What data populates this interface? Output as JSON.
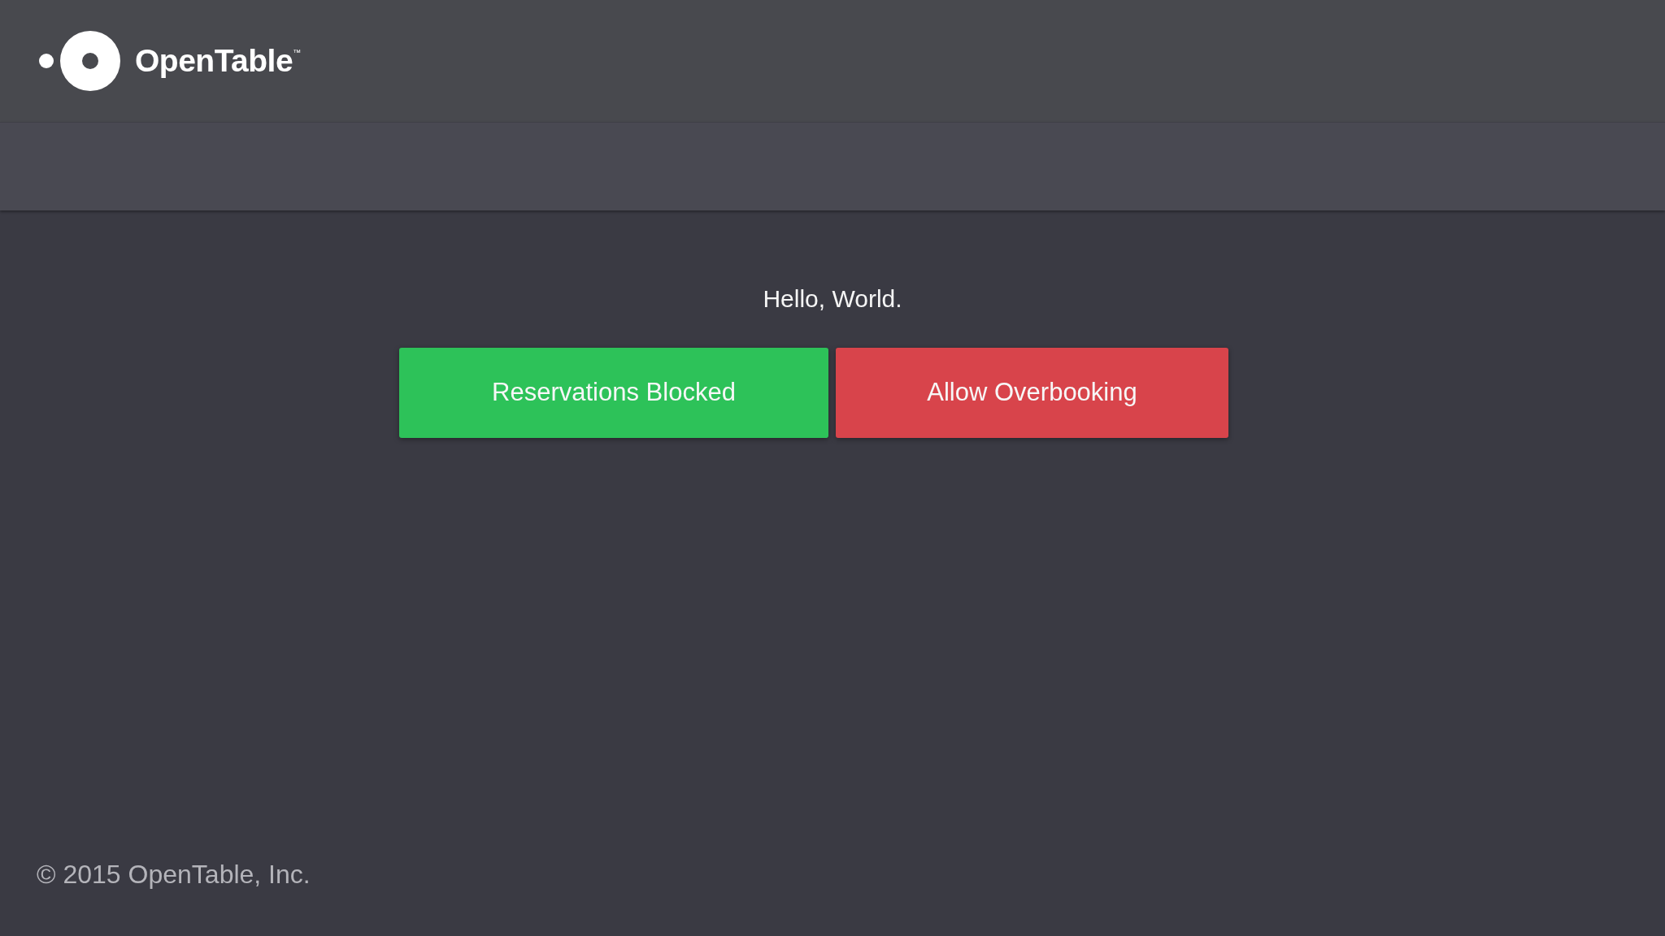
{
  "header": {
    "logo": {
      "wordmark": "OpenTable",
      "trademark": "™"
    }
  },
  "main": {
    "greeting": "Hello, World.",
    "buttons": [
      {
        "label": "Reservations Blocked",
        "kind": "success"
      },
      {
        "label": "Allow Overbooking",
        "kind": "danger"
      }
    ]
  },
  "footer": {
    "copyright": "© 2015 OpenTable, Inc."
  }
}
